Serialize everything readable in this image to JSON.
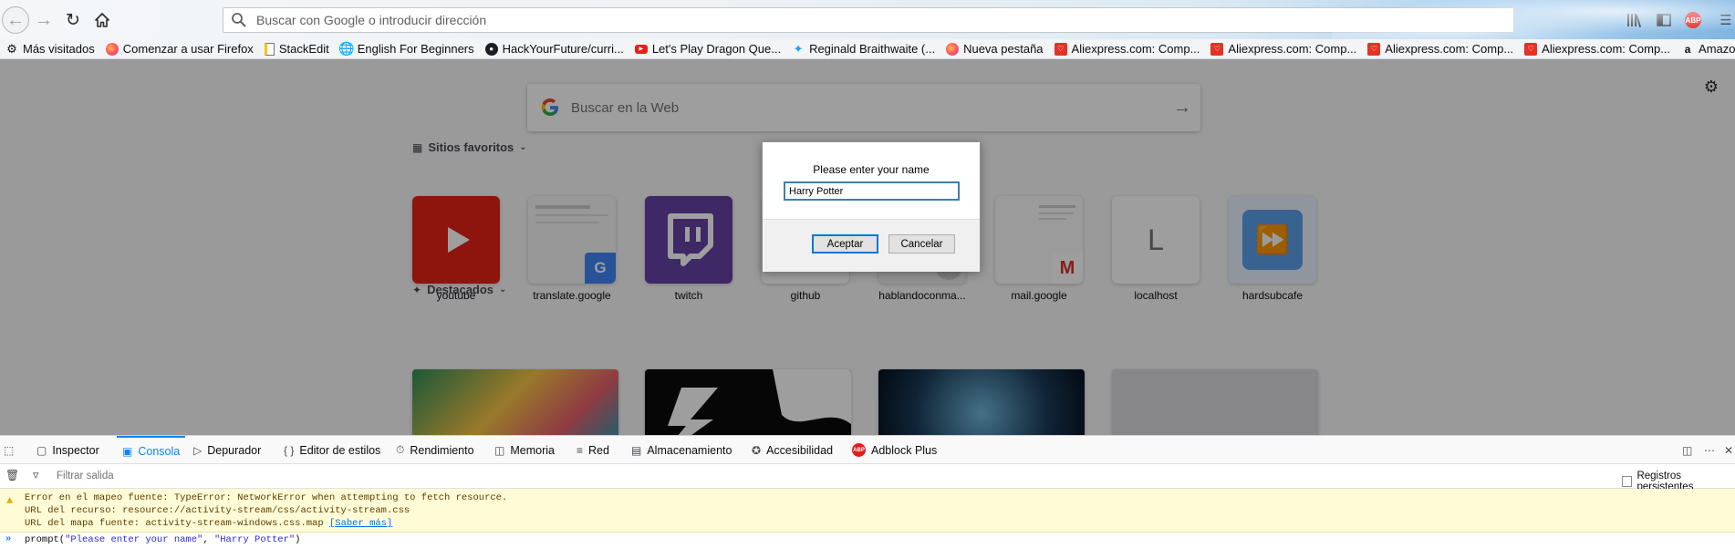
{
  "toolbar": {
    "url_placeholder": "Buscar con Google o introducir dirección",
    "abp_badge": "ABP"
  },
  "bookmarks": [
    {
      "label": "Más visitados",
      "icon": "gear-icon"
    },
    {
      "label": "Comenzar a usar Firefox",
      "icon": "firefox-icon"
    },
    {
      "label": "StackEdit",
      "icon": "page-icon"
    },
    {
      "label": "English For Beginners",
      "icon": "globe-icon"
    },
    {
      "label": "HackYourFuture/curri...",
      "icon": "github-icon"
    },
    {
      "label": "Let's Play Dragon Que...",
      "icon": "youtube-icon"
    },
    {
      "label": "Reginald Braithwaite (...",
      "icon": "twitter-icon"
    },
    {
      "label": "Nueva pestaña",
      "icon": "firefox-icon"
    },
    {
      "label": "Aliexpress.com: Comp...",
      "icon": "aliexpress-icon"
    },
    {
      "label": "Aliexpress.com: Comp...",
      "icon": "aliexpress-icon"
    },
    {
      "label": "Aliexpress.com: Comp...",
      "icon": "aliexpress-icon"
    },
    {
      "label": "Aliexpress.com: Comp...",
      "icon": "aliexpress-icon"
    },
    {
      "label": "Amazon.com: Boscia ...",
      "icon": "amazon-icon"
    }
  ],
  "newtab": {
    "search_placeholder": "Buscar en la Web",
    "top_sites_title": "Sitios favoritos",
    "highlights_title": "Destacados",
    "top_sites": [
      {
        "label": "youtube"
      },
      {
        "label": "translate.google"
      },
      {
        "label": "twitch"
      },
      {
        "label": "github"
      },
      {
        "label": "hablandoconma..."
      },
      {
        "label": "mail.google"
      },
      {
        "label": "localhost",
        "letter": "L"
      },
      {
        "label": "hardsubcafe"
      }
    ]
  },
  "dialog": {
    "message": "Please enter your name",
    "value": "Harry Potter",
    "ok_label": "Aceptar",
    "cancel_label": "Cancelar"
  },
  "devtools": {
    "tabs": [
      {
        "label": "Inspector",
        "icon": "inspector-icon"
      },
      {
        "label": "Consola",
        "icon": "console-icon",
        "selected": true
      },
      {
        "label": "Depurador",
        "icon": "debugger-icon"
      },
      {
        "label": "Editor de estilos",
        "icon": "braces-icon"
      },
      {
        "label": "Rendimiento",
        "icon": "performance-icon"
      },
      {
        "label": "Memoria",
        "icon": "memory-icon"
      },
      {
        "label": "Red",
        "icon": "network-icon"
      },
      {
        "label": "Almacenamiento",
        "icon": "storage-icon"
      },
      {
        "label": "Accesibilidad",
        "icon": "accessibility-icon"
      },
      {
        "label": "Adblock Plus",
        "icon": "abp-icon"
      }
    ],
    "filter_placeholder": "Filtrar salida",
    "persist_label": "Registros persistentes",
    "warning": {
      "line1": "Error en el mapeo fuente: TypeError: NetworkError when attempting to fetch resource.",
      "line2": "URL del recurso: resource://activity-stream/css/activity-stream.css",
      "line3": "URL del mapa fuente: activity-stream-windows.css.map",
      "link": "[Saber más]"
    },
    "command": {
      "fn": "prompt(",
      "arg1": "\"Please enter your name\"",
      "sep": ", ",
      "arg2": "\"Harry Potter\"",
      "end": ")"
    }
  },
  "colors": {
    "accent": "#0a84ff",
    "warning_bg": "#fffbd6",
    "youtube": "#e62117",
    "twitch": "#6441a4"
  }
}
